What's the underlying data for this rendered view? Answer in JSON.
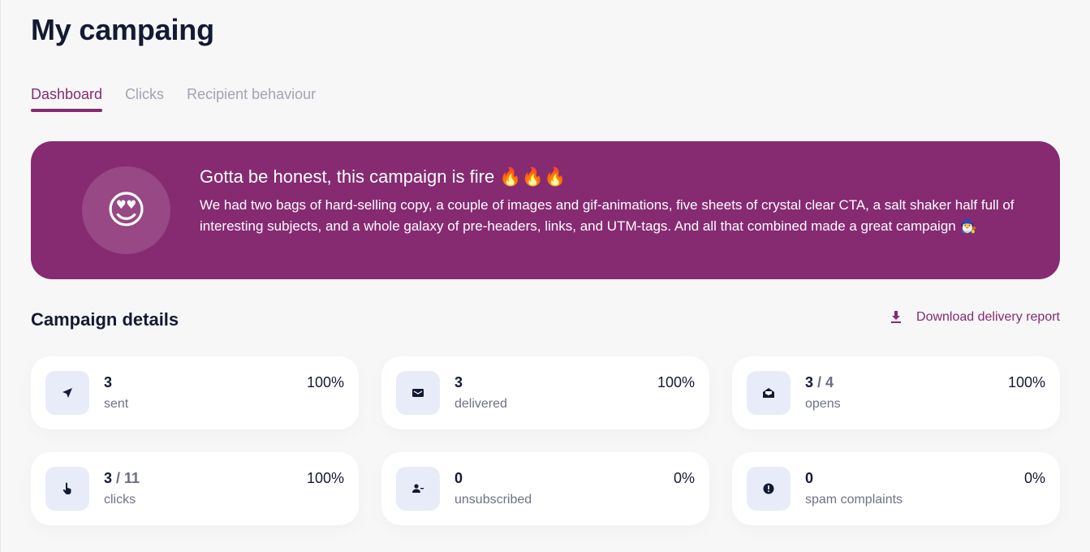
{
  "header": {
    "title": "My campaing"
  },
  "tabs": [
    {
      "label": "Dashboard",
      "active": true
    },
    {
      "label": "Clicks",
      "active": false
    },
    {
      "label": "Recipient behaviour",
      "active": false
    }
  ],
  "banner": {
    "emoji": "😍",
    "title": "Gotta be honest, this campaign is fire 🔥🔥🔥",
    "text": "We had two bags of hard-selling copy, a couple of images and gif-animations, five sheets of crystal clear CTA, a salt shaker half full of interesting subjects, and a whole galaxy of pre-headers, links, and UTM-tags. And all that combined made a great campaign 🧙‍♂️",
    "background": "#862a72"
  },
  "details": {
    "title": "Campaign details",
    "download_label": "Download delivery report",
    "cards": [
      {
        "icon": "send-icon",
        "value": "3",
        "total": "",
        "label": "sent",
        "percent": "100%"
      },
      {
        "icon": "envelope-icon",
        "value": "3",
        "total": "",
        "label": "delivered",
        "percent": "100%"
      },
      {
        "icon": "envelope-open-icon",
        "value": "3",
        "total": "4",
        "label": "opens",
        "percent": "100%"
      },
      {
        "icon": "pointer-hand-icon",
        "value": "3",
        "total": "11",
        "label": "clicks",
        "percent": "100%"
      },
      {
        "icon": "user-minus-icon",
        "value": "0",
        "total": "",
        "label": "unsubscribed",
        "percent": "0%"
      },
      {
        "icon": "alert-circle-icon",
        "value": "0",
        "total": "",
        "label": "spam complaints",
        "percent": "0%"
      }
    ]
  },
  "colors": {
    "accent": "#862a72",
    "text": "#131a33",
    "muted": "#a2a4b3",
    "icon_bg": "#e7ecf8"
  }
}
